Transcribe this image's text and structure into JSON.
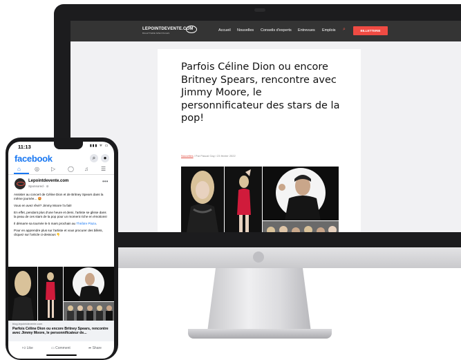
{
  "website": {
    "logo": "LEPOINTDEVENTE.COM",
    "logo_sub": "BILLETTERIE SPECTACLES",
    "nav": [
      "Accueil",
      "Nouvelles",
      "Conseils d'experts",
      "Entrevues",
      "Emplois"
    ],
    "cta": "BILLETTERIE",
    "article": {
      "title": "Parfois Céline Dion ou encore Britney Spears, rencontre avec Jimmy Moore, le personnificateur des stars de la pop!",
      "category": "Nouvelles",
      "meta_rest": " / Par Pascal Gay / 23 février 2022"
    }
  },
  "phone": {
    "time": "11:13",
    "status": "▮▮▮ ᯤ ▭",
    "brand": "facebook",
    "post": {
      "page_name": "Lepointdevente.com",
      "sponsored": "Sponsored · ⊘",
      "p1": "Assister au concert de Céline Dion et de Britney Spears dans la même journée... 🤩",
      "p2": "Vous en avez rêvé? Jimmy Moore l'a fait!",
      "p3": "En effet, pendant plus d'une heure et demi, l'artiste se glisse dans la peau de ces stars de la pop pour un moment riche en émotions!",
      "p4_pre": "Il démarre sa tournée le 5 mars prochain au ",
      "p4_link": "Théâtre Plaza",
      "p4_post": ".",
      "p5": "Pour en apprendre plus sur l'artiste et vous procurer des billets, cliquez sur l'article ci-dessous 👇",
      "link_domain": "blog.lepointdevente.com",
      "link_title": "Parfois Céline Dion ou encore Britney Spears, rencontre avec Jimmy Moore, le personnificateur de..."
    },
    "actions": {
      "like": "Like",
      "comment": "Comment",
      "share": "Share"
    }
  }
}
